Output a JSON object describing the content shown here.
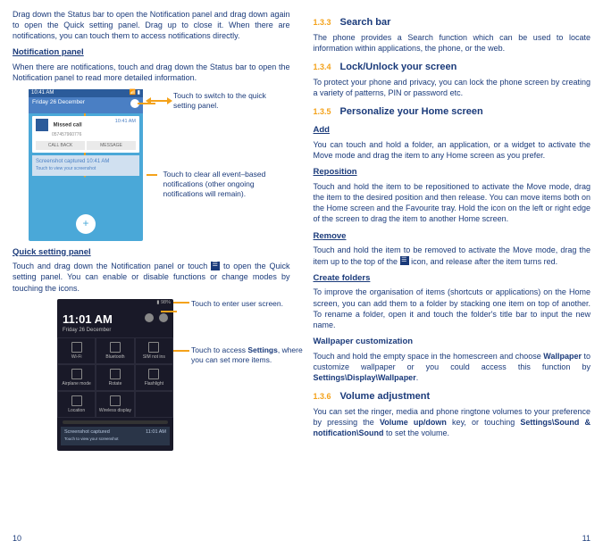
{
  "left": {
    "intro": "Drag down the Status bar to open the Notification panel and drag down again to open the Quick setting panel. Drag up to close it. When there are notifications, you can touch them to access notifications directly.",
    "notif_panel_heading": "Notification panel",
    "notif_panel_text": "When there are notifications, touch and drag down the Status bar to open the Notification panel to read more detailed information.",
    "annot_switch": "Touch to switch to the quick setting panel.",
    "annot_clear": "Touch to clear all event–based notifications (other ongoing notifications will remain).",
    "phone1": {
      "time_small": "10:41 AM",
      "date": "Friday 26 December",
      "missed_title": "Missed call",
      "missed_num": "057457960776",
      "missed_time": "10:41 AM",
      "btn_call": "CALL BACK",
      "btn_msg": "MESSAGE",
      "shot_title": "Screenshot captured",
      "shot_sub": "Touch to view your screenshot",
      "shot_time": "10:41 AM"
    },
    "quick_heading": "Quick setting panel",
    "quick_text_a": "Touch and drag down the Notification panel or touch ",
    "quick_text_b": " to open the Quick setting panel. You can enable or disable functions or change modes by touching the icons.",
    "annot_user": "Touch to enter user screen.",
    "annot_settings_a": "Touch to access ",
    "annot_settings_bold": "Settings",
    "annot_settings_b": ", where you can set more items.",
    "phone2": {
      "battery": "98%",
      "time": "11:01 AM",
      "date": "Friday 26 December",
      "q": [
        "Wi-Fi",
        "Bluetooth",
        "SIM not ins",
        "Airplane mode",
        "Rotate",
        "Flashlight",
        "Location",
        "Wireless display"
      ],
      "notif_title": "Screenshot captured",
      "notif_sub": "Touch to view your screenshot",
      "notif_time": "11:01 AM"
    },
    "page_num": "10"
  },
  "right": {
    "s133_num": "1.3.3",
    "s133_title": "Search bar",
    "s133_text": "The phone provides a Search function which can be used to locate information within applications, the phone, or the web.",
    "s134_num": "1.3.4",
    "s134_title": "Lock/Unlock your screen",
    "s134_text": "To protect your phone and privacy, you can lock the phone screen by creating a variety of patterns, PIN or password etc.",
    "s135_num": "1.3.5",
    "s135_title": "Personalize your Home screen",
    "add_h": "Add",
    "add_t": "You can touch and hold a folder, an application, or a widget to activate the Move mode and drag the item to any Home screen as you prefer.",
    "rep_h": "Reposition",
    "rep_t": "Touch and hold the item to be repositioned to activate the Move mode, drag the item to the desired position and then release. You can move items both on the Home screen and the Favourite tray. Hold the icon on the left or right edge of the screen to drag the item to another Home screen.",
    "rem_h": "Remove",
    "rem_t_a": "Touch and hold the item to be removed to activate the Move mode, drag the item up to the top of the ",
    "rem_t_b": " icon, and release after the item turns red.",
    "cf_h": "Create folders",
    "cf_t": "To improve the organisation of items (shortcuts or applications) on the Home screen, you can add them to a folder by stacking one item on top of another. To rename a folder, open it and touch the folder's title bar to input the new name.",
    "wp_h": "Wallpaper customization",
    "wp_t_a": "Touch and hold the empty space in the homescreen and choose ",
    "wp_bold1": "Wallpaper",
    "wp_t_b": " to customize wallpaper or you could access this function by ",
    "wp_bold2": "Settings\\Display\\Wallpaper",
    "wp_t_c": ".",
    "s136_num": "1.3.6",
    "s136_title": "Volume adjustment",
    "s136_t_a": "You can set the ringer, media and phone ringtone volumes to your preference by pressing the ",
    "s136_bold1": "Volume up/down",
    "s136_t_b": " key, or touching ",
    "s136_bold2": "Settings\\Sound & notification\\Sound",
    "s136_t_c": " to set the volume.",
    "page_num": "11"
  }
}
